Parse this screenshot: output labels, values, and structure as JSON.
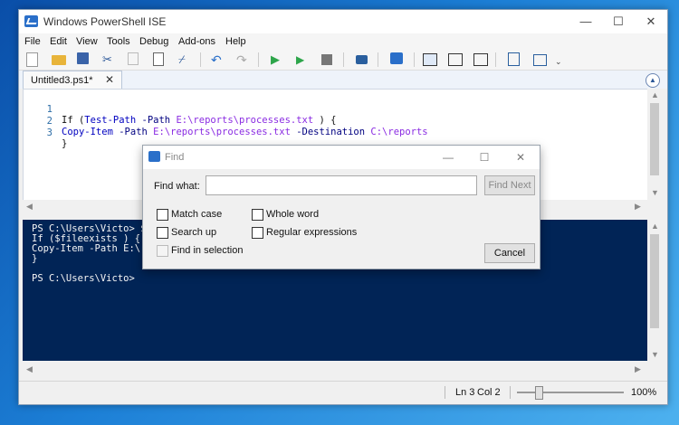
{
  "window": {
    "title": "Windows PowerShell ISE",
    "min_glyph": "—",
    "max_glyph": "☐",
    "close_glyph": "✕"
  },
  "menu": [
    "File",
    "Edit",
    "View",
    "Tools",
    "Debug",
    "Add-ons",
    "Help"
  ],
  "toolbar": {
    "icons": [
      "new-file-icon",
      "open-folder-icon",
      "save-icon",
      "cut-icon",
      "copy-icon",
      "paste-icon",
      "clear-icon",
      "undo-icon",
      "redo-icon",
      "run-icon",
      "run-selection-icon",
      "stop-icon",
      "remote-icon",
      "powershell-icon",
      "layout-top-icon",
      "layout-right-icon",
      "layout-max-icon",
      "snippet-icon",
      "addon-icon",
      "overflow-icon"
    ]
  },
  "tab": {
    "label": "Untitled3.ps1*",
    "close_glyph": "✕"
  },
  "editor": {
    "lines": [
      {
        "num": "1",
        "parts": [
          {
            "t": "If (",
            "c": "plain"
          },
          {
            "t": "Test-Path",
            "c": "cmd"
          },
          {
            "t": " -Path ",
            "c": "param"
          },
          {
            "t": "E:\\reports\\processes.txt",
            "c": "strv"
          },
          {
            "t": " ) {",
            "c": "plain"
          }
        ]
      },
      {
        "num": "2",
        "parts": [
          {
            "t": "Copy-Item",
            "c": "cmd"
          },
          {
            "t": " -Path ",
            "c": "param"
          },
          {
            "t": "E:\\reports\\processes.txt",
            "c": "strv"
          },
          {
            "t": " -Destination ",
            "c": "param"
          },
          {
            "t": "C:\\reports",
            "c": "strv"
          }
        ]
      },
      {
        "num": "3",
        "parts": [
          {
            "t": "}",
            "c": "plain"
          }
        ]
      }
    ]
  },
  "console": {
    "lines": [
      "PS C:\\Users\\Victo> $",
      "If ($fileexists ) {",
      "Copy-Item -Path E:\\r",
      "}",
      "",
      "PS C:\\Users\\Victo>"
    ]
  },
  "status": {
    "ln": "Ln 3",
    "col": "Col 2",
    "zoom": "100%",
    "zoom_slider_percent": 100
  },
  "find_dialog": {
    "title": "Find",
    "find_what_label": "Find what:",
    "find_what_value": "",
    "find_next_label": "Find Next",
    "cancel_label": "Cancel",
    "options": {
      "match_case": "Match case",
      "whole_word": "Whole word",
      "search_up": "Search up",
      "regex": "Regular expressions",
      "find_in_selection": "Find in selection"
    }
  },
  "colors": {
    "console_bg": "#012456",
    "accent": "#2a6fc9"
  }
}
